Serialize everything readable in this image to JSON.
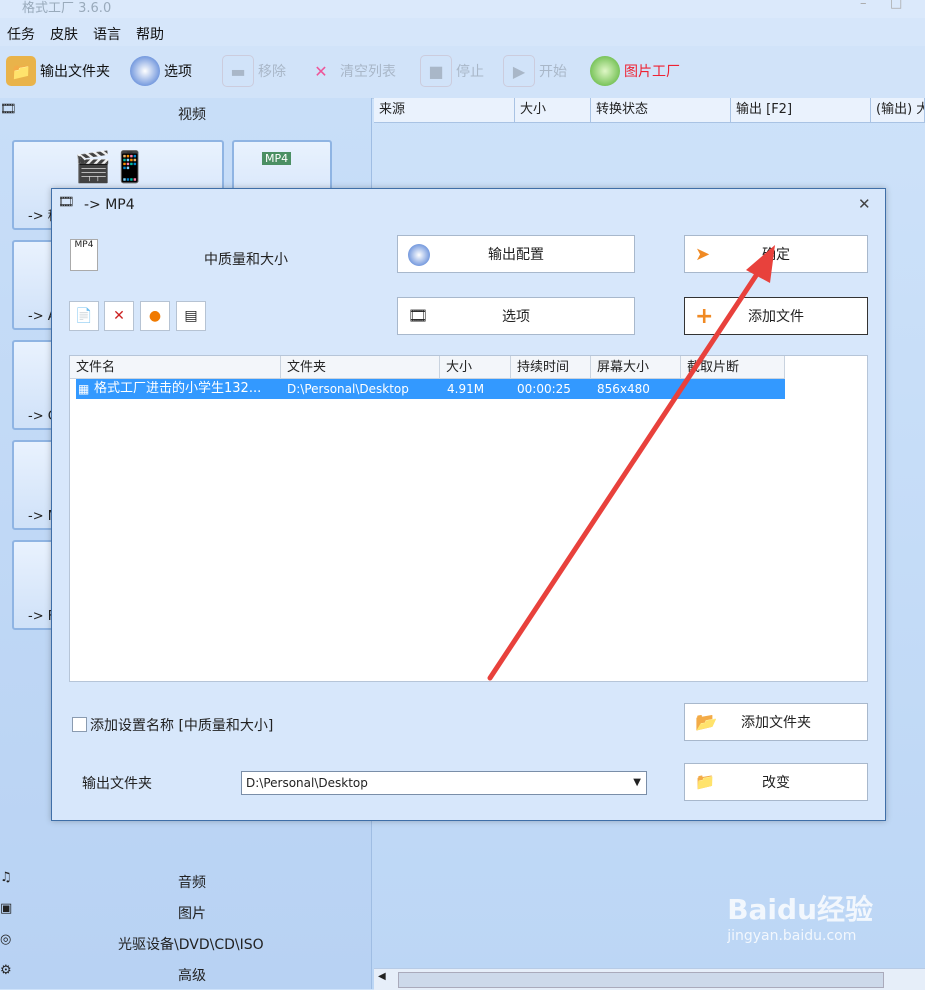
{
  "window": {
    "title": "格式工厂 3.6.0"
  },
  "menu": [
    "任务",
    "皮肤",
    "语言",
    "帮助"
  ],
  "toolbar": {
    "output_folder": "输出文件夹",
    "options": "选项",
    "remove": "移除",
    "clear_list": "清空列表",
    "stop": "停止",
    "start": "开始",
    "picture_factory": "图片工厂"
  },
  "left": {
    "video_header": "视频",
    "tiles": [
      "-> 移",
      "-> A",
      "-> G",
      "-> M",
      "-> F"
    ],
    "audio": "音频",
    "picture": "图片",
    "optical": "光驱设备\\DVD\\CD\\ISO",
    "advanced": "高级"
  },
  "list_header": [
    "来源",
    "大小",
    "转换状态",
    "输出 [F2]",
    "(输出) 大"
  ],
  "dialog": {
    "title": "-> MP4",
    "quality": "中质量和大小",
    "output_config": "输出配置",
    "ok": "确定",
    "options": "选项",
    "add_file": "添加文件",
    "columns": [
      "文件名",
      "文件夹",
      "大小",
      "持续时间",
      "屏幕大小",
      "截取片断"
    ],
    "row": {
      "name": "格式工厂进击的小学生132...",
      "folder": "D:\\Personal\\Desktop",
      "size": "4.91M",
      "duration": "00:00:25",
      "screen": "856x480"
    },
    "add_setting_name": "添加设置名称 [中质量和大小]",
    "add_folder": "添加文件夹",
    "output_folder_label": "输出文件夹",
    "output_folder_value": "D:\\Personal\\Desktop",
    "change": "改变"
  },
  "watermark": {
    "brand": "Baidu经验",
    "url": "jingyan.baidu.com"
  },
  "colors": {
    "selection": "#3399ff",
    "arrow": "#e8413c",
    "dialog_bg": "#d7e7fb"
  }
}
